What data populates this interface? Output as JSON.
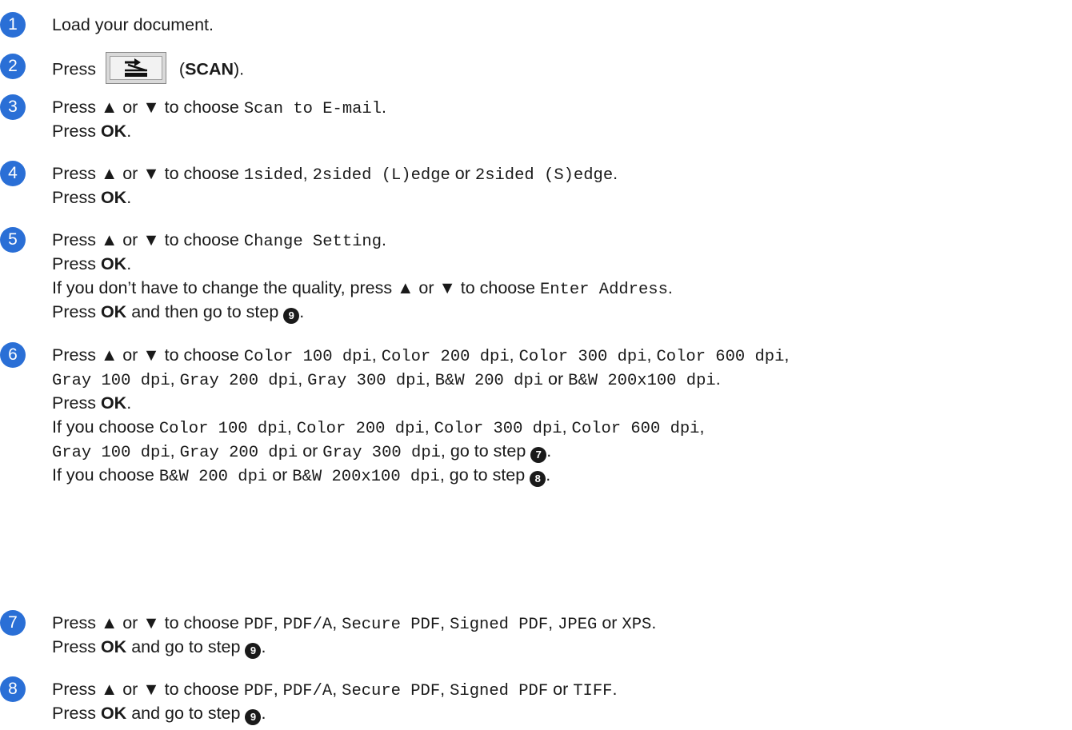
{
  "steps": [
    {
      "num": "1",
      "text": "Load your document."
    },
    {
      "num": "2",
      "press": "Press",
      "button_label": "SCAN",
      "icon": "scan-icon"
    },
    {
      "num": "3"
    },
    {
      "num": "4"
    },
    {
      "num": "5"
    },
    {
      "num": "6"
    },
    {
      "num": "7"
    },
    {
      "num": "8"
    }
  ],
  "words": {
    "press": "Press",
    "ok": "OK",
    "or": "or",
    "to_choose": "to choose",
    "up_glyph": "▲",
    "down_glyph": "▼",
    "go_to_step": "go to step",
    "and_then_go": "and then go to step",
    "and_go": "and go to step"
  },
  "options": {
    "s3": [
      "Scan to E-mail"
    ],
    "s4": [
      "1sided",
      "2sided (L)edge",
      "2sided (S)edge"
    ],
    "s5": [
      "Change Setting",
      "Enter Address"
    ],
    "s6_all": [
      "Color 100 dpi",
      "Color 200 dpi",
      "Color 300 dpi",
      "Color 600 dpi",
      "Gray 100 dpi",
      "Gray 200 dpi",
      "Gray 300 dpi",
      "B&W 200 dpi",
      "B&W 200x100 dpi"
    ],
    "s7": [
      "PDF",
      "PDF/A",
      "Secure PDF",
      "Signed PDF",
      "JPEG",
      "XPS"
    ],
    "s8": [
      "PDF",
      "PDF/A",
      "Secure PDF",
      "Signed PDF",
      "TIFF"
    ]
  },
  "text": {
    "s5_note": "If you don’t have to change the quality, press",
    "s6_if": "If you choose",
    "refs": {
      "seven": "7",
      "eight": "8",
      "nine": "9"
    }
  }
}
